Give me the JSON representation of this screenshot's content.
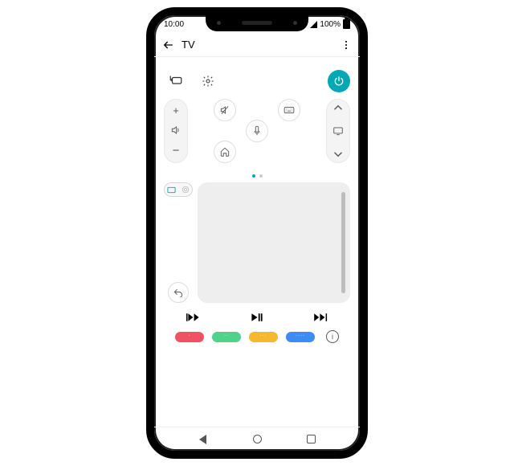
{
  "status": {
    "time": "10:00",
    "battery": "100%"
  },
  "header": {
    "title": "TV"
  },
  "icons": {
    "input": "input-icon",
    "settings": "settings-icon",
    "power": "power-icon",
    "vol_up": "+",
    "vol_down": "−",
    "speaker": "speaker-icon",
    "mute": "mute-icon",
    "keyboard": "keyboard-icon",
    "mic": "mic-icon",
    "home": "home-icon",
    "ch_up": "chevron-up",
    "display": "display-icon",
    "ch_down": "chevron-down",
    "undo": "undo-icon"
  },
  "media": {
    "prev": "prev-icon",
    "play": "play-pause-icon",
    "next": "next-icon"
  },
  "color_buttons": [
    "red",
    "green",
    "yellow",
    "blue"
  ],
  "colors": {
    "accent": "#00a8b3",
    "red": "#ef5262",
    "green": "#4fd28a",
    "yellow": "#f5b82e",
    "blue": "#3b8df5"
  }
}
